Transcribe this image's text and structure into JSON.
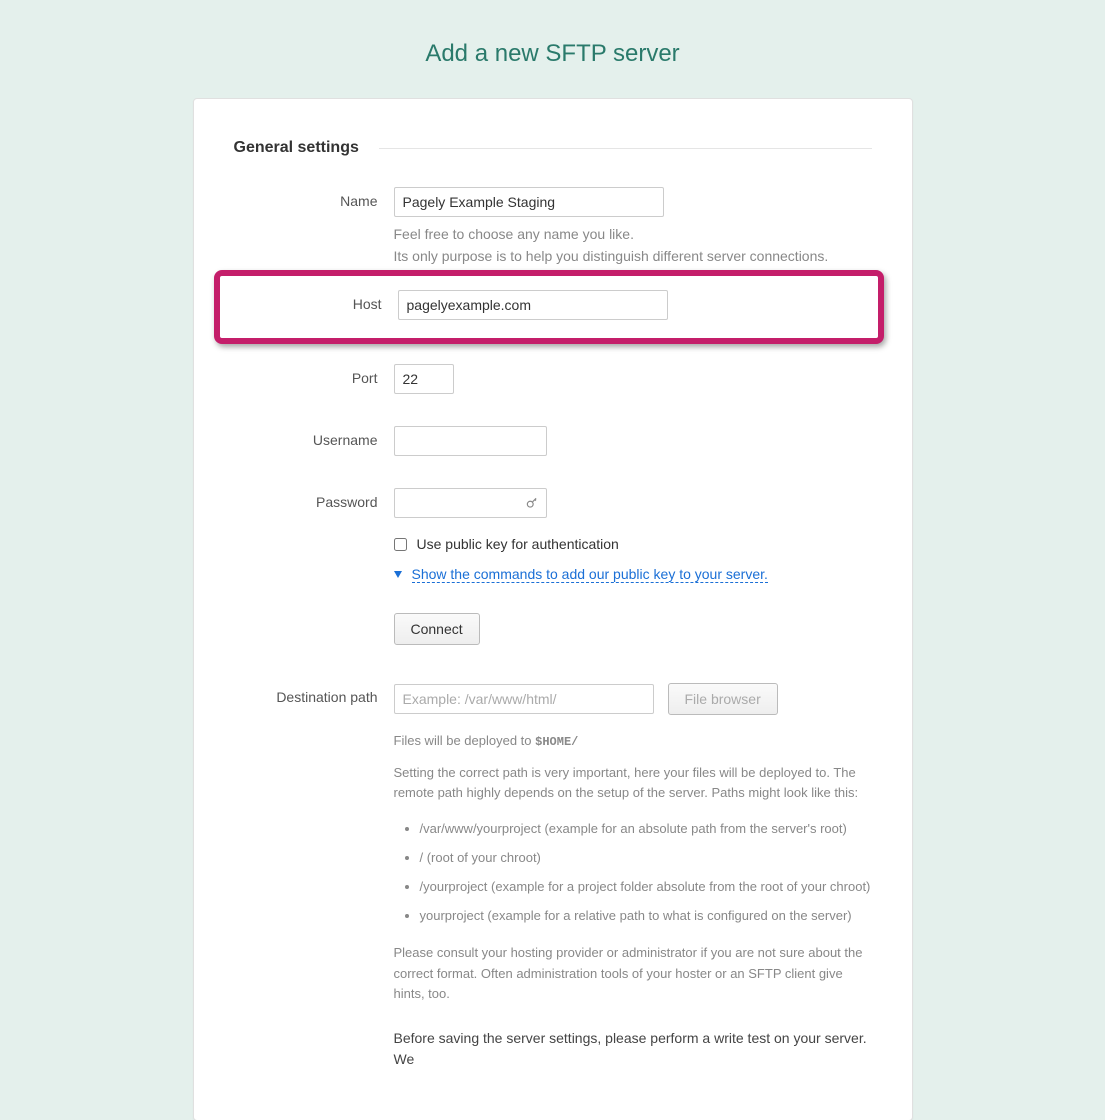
{
  "page_title": "Add a new SFTP server",
  "section": "General settings",
  "fields": {
    "name": {
      "label": "Name",
      "value": "Pagely Example Staging",
      "help1": "Feel free to choose any name you like.",
      "help2": "Its only purpose is to help you distinguish different server connections."
    },
    "host": {
      "label": "Host",
      "value": "pagelyexample.com"
    },
    "port": {
      "label": "Port",
      "value": "22"
    },
    "username": {
      "label": "Username",
      "value": ""
    },
    "password": {
      "label": "Password",
      "value": ""
    },
    "pubkey_label": "Use public key for authentication",
    "show_commands_link": "Show the commands to add our public key to your server.",
    "connect_button": "Connect",
    "destination": {
      "label": "Destination path",
      "placeholder": "Example: /var/www/html/",
      "file_browser": "File browser",
      "deployed_to_pre": "Files will be deployed to ",
      "deployed_to_mono": "$HOME/",
      "setting_text": "Setting the correct path is very important, here your files will be deployed to. The remote path highly depends on the setup of the server. Paths might look like this:",
      "examples": [
        "/var/www/yourproject (example for an absolute path from the server's root)",
        "/ (root of your chroot)",
        "/yourproject (example for a project folder absolute from the root of your chroot)",
        "yourproject (example for a relative path to what is configured on the server)"
      ],
      "consult": "Please consult your hosting provider or administrator if you are not sure about the correct format. Often administration tools of your hoster or an SFTP client give hints, too.",
      "save_note": "Before saving the server settings, please perform a write test on your server. We"
    }
  }
}
